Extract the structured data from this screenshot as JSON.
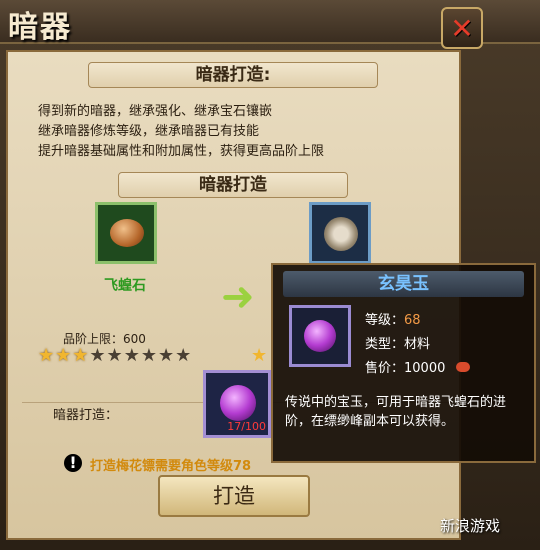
{
  "window": {
    "title": "暗器",
    "close_icon": "close-icon"
  },
  "section": {
    "header": "暗器打造:",
    "lines": [
      "得到新的暗器，继承强化、继承宝石镶嵌",
      "继承暗器修炼等级，继承暗器已有技能",
      "提升暗器基础属性和附加属性，获得更高品阶上限"
    ]
  },
  "craft": {
    "header": "暗器打造",
    "source_item": {
      "name": "飞蝗石",
      "stars": 3,
      "max_stars": 9,
      "icon": "stone-icon"
    },
    "target_item": {
      "icon": "flower-dart-icon"
    },
    "grade_limit": "品阶上限：600",
    "materials_label": "暗器打造：",
    "material_count": "17/100",
    "warning": "打造梅花镖需要角色等级78",
    "button": "打造"
  },
  "tooltip": {
    "title": "玄昊玉",
    "level_label": "等级：",
    "level": "68",
    "type_label": "类型：",
    "type": "材料",
    "price_label": "售价：",
    "price": "10000",
    "description": "传说中的宝玉，可用于暗器飞蝗石的进阶，在缥缈峰副本可以获得。"
  },
  "watermark": "新浪游戏"
}
